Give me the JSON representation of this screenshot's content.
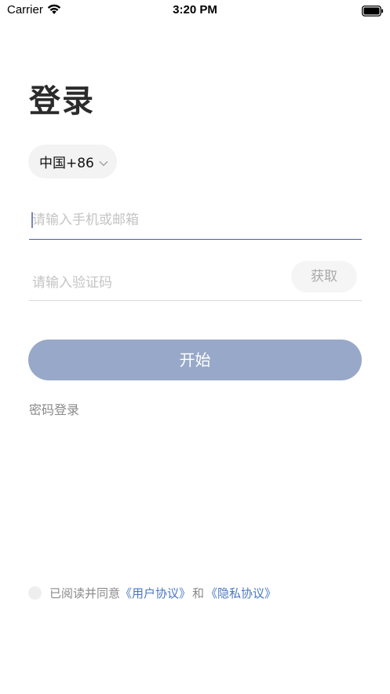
{
  "status_bar": {
    "carrier": "Carrier",
    "time": "3:20 PM"
  },
  "title": "登录",
  "country_selector": {
    "label": "中国+86"
  },
  "phone_input": {
    "placeholder": "请输入手机或邮箱",
    "value": ""
  },
  "code_input": {
    "placeholder": "请输入验证码",
    "value": ""
  },
  "get_code_button": "获取",
  "start_button": "开始",
  "password_login_link": "密码登录",
  "agreement": {
    "prefix": "已阅读并同意",
    "user_agreement": "《用户协议》",
    "conjunction": "和",
    "privacy_agreement": "《隐私协议》"
  },
  "colors": {
    "accent": "#98a8c8",
    "link": "#4a78c2",
    "focus_underline": "#4a5b9c"
  }
}
